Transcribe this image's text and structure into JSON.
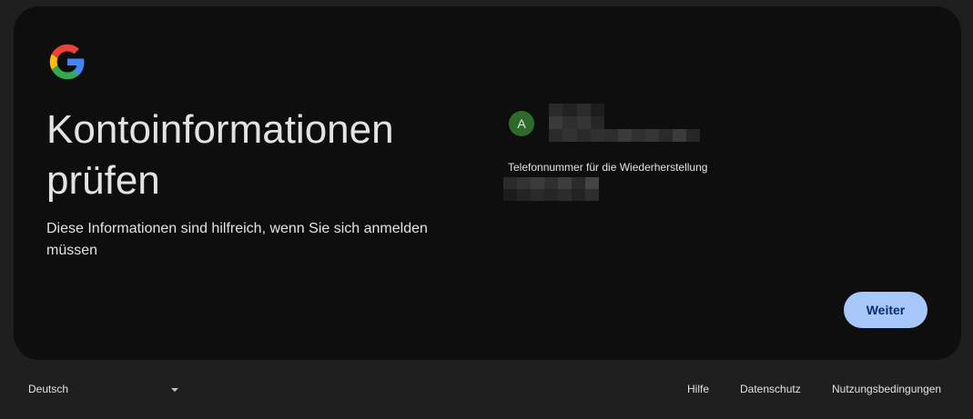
{
  "card": {
    "title": "Kontoinformationen prüfen",
    "subtitle": "Diese Informationen sind hilfreich, wenn Sie sich anmelden müssen",
    "avatar_letter": "A",
    "recovery_phone_label": "Telefonnummer für die Wiederherstellung",
    "continue_label": "Weiter"
  },
  "footer": {
    "language": "Deutsch",
    "links": [
      "Hilfe",
      "Datenschutz",
      "Nutzungsbedingungen"
    ]
  },
  "colors": {
    "background": "#1f1f1f",
    "card": "#0e0e0f",
    "primary_button": "#a8c7fa",
    "primary_button_text": "#062e6f",
    "avatar": "#2e6b2b"
  }
}
